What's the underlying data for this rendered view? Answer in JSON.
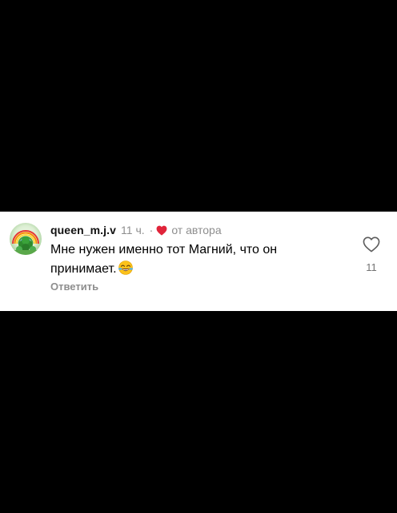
{
  "comment": {
    "username": "queen_m.j.v",
    "time": "11 ч.",
    "separator": "·",
    "author_badge_label": "от автора",
    "text": "Мне нужен именно тот Магний, что он принимает.",
    "emoji": "face-with-tears-of-joy",
    "reply_label": "Ответить",
    "like_count": "11",
    "like_icon": "heart-outline-icon",
    "author_heart_icon": "heart-filled-icon",
    "author_heart_color": "#e0243a",
    "avatar_icon": "rainbow-clover-avatar"
  },
  "colors": {
    "background": "#000000",
    "card": "#ffffff",
    "muted_text": "#8e8e8e"
  }
}
